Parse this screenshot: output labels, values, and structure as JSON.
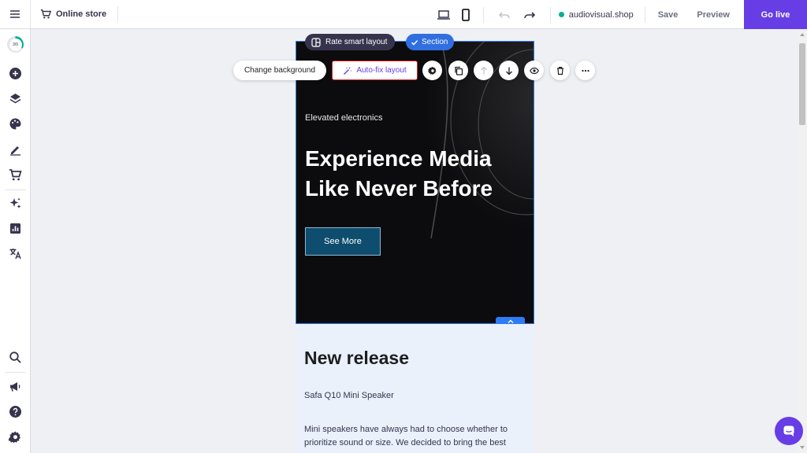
{
  "topbar": {
    "store_title": "Online store",
    "domain": "audiovisual.shop",
    "save": "Save",
    "preview": "Preview",
    "go_live": "Go live"
  },
  "sidebar": {
    "progress_label": "3/9",
    "progress_fraction": 0.33
  },
  "editor": {
    "rate_badge": "Rate smart layout",
    "section_badge": "Section",
    "change_background": "Change background",
    "auto_fix": "Auto-fix layout"
  },
  "hero": {
    "eyebrow": "Elevated electronics",
    "title": "Experience Media Like Never Before",
    "button": "See More"
  },
  "release": {
    "title": "New release",
    "subtitle": "Safa Q10 Mini Speaker",
    "body": "Mini speakers have always had to choose whether to prioritize sound or size. We decided to bring the best"
  },
  "colors": {
    "brand": "#673de6",
    "selection": "#2f7bf5",
    "hero_bg": "#0c0c0e",
    "cta": "#0e4d6e",
    "release_bg": "#eaf1fb"
  }
}
